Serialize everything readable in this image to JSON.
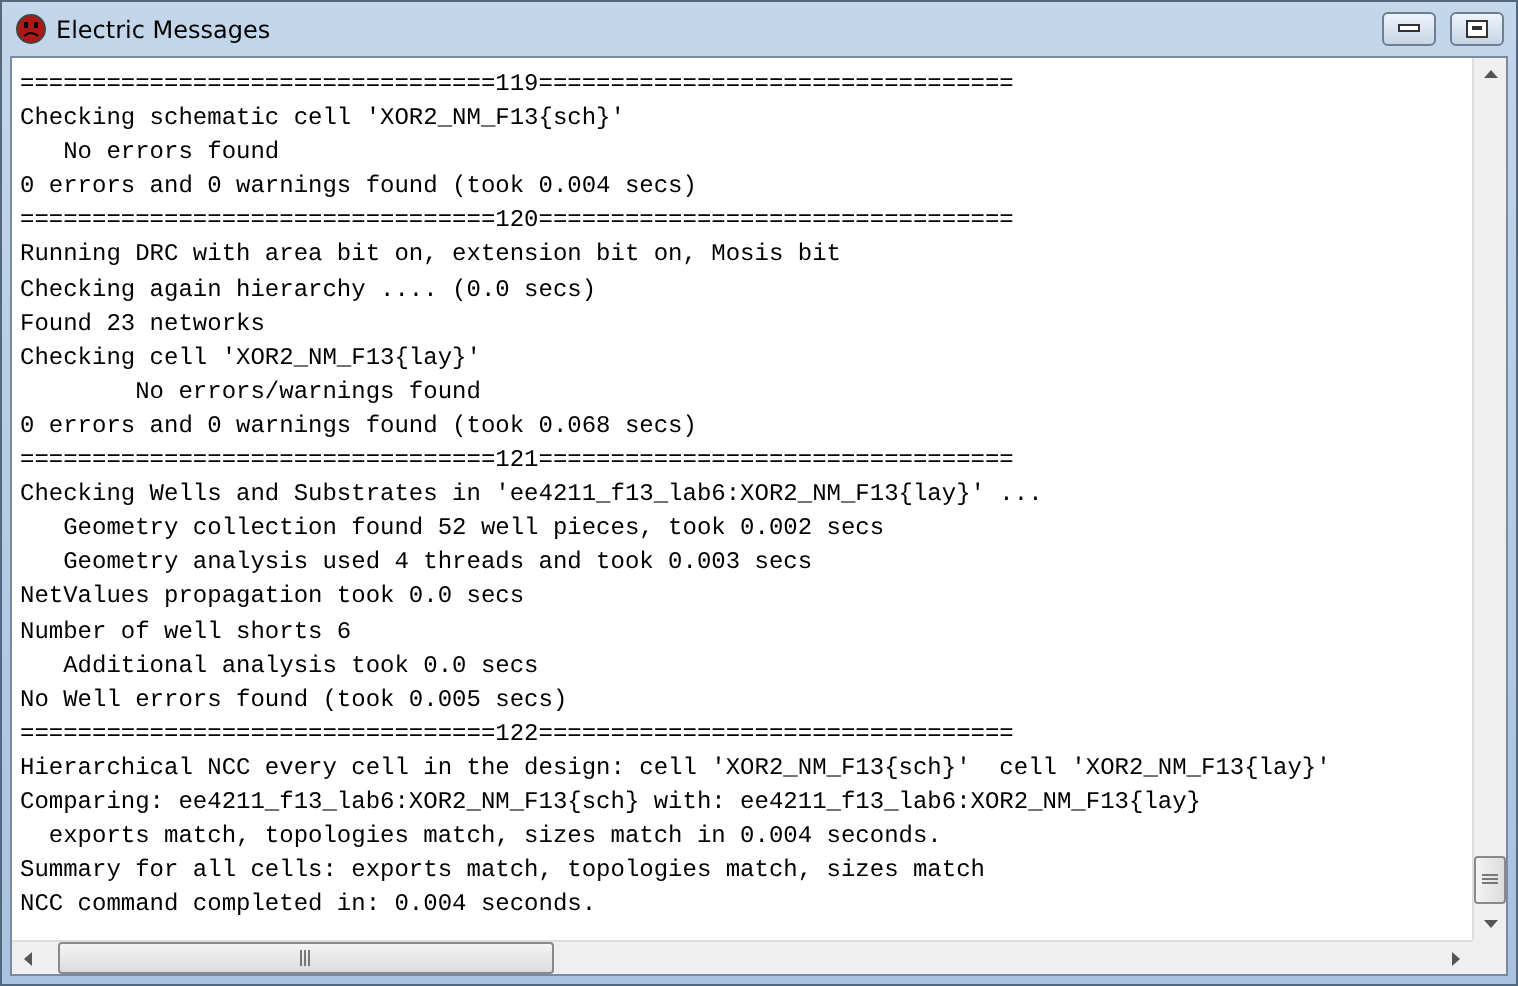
{
  "window": {
    "title": "Electric Messages"
  },
  "lines": [
    "=================================119=================================",
    "Checking schematic cell 'XOR2_NM_F13{sch}'",
    "   No errors found",
    "0 errors and 0 warnings found (took 0.004 secs)",
    "=================================120=================================",
    "Running DRC with area bit on, extension bit on, Mosis bit",
    "Checking again hierarchy .... (0.0 secs)",
    "Found 23 networks",
    "Checking cell 'XOR2_NM_F13{lay}'",
    "        No errors/warnings found",
    "0 errors and 0 warnings found (took 0.068 secs)",
    "=================================121=================================",
    "Checking Wells and Substrates in 'ee4211_f13_lab6:XOR2_NM_F13{lay}' ...",
    "   Geometry collection found 52 well pieces, took 0.002 secs",
    "   Geometry analysis used 4 threads and took 0.003 secs",
    "NetValues propagation took 0.0 secs",
    "Number of well shorts 6",
    "   Additional analysis took 0.0 secs",
    "No Well errors found (took 0.005 secs)",
    "=================================122=================================",
    "Hierarchical NCC every cell in the design: cell 'XOR2_NM_F13{sch}'  cell 'XOR2_NM_F13{lay}'",
    "Comparing: ee4211_f13_lab6:XOR2_NM_F13{sch} with: ee4211_f13_lab6:XOR2_NM_F13{lay}",
    "  exports match, topologies match, sizes match in 0.004 seconds.",
    "Summary for all cells: exports match, topologies match, sizes match",
    "NCC command completed in: 0.004 seconds."
  ]
}
